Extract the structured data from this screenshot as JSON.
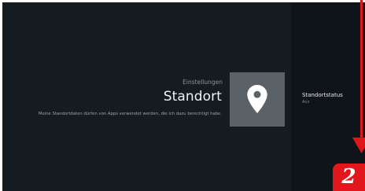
{
  "header": {
    "breadcrumb": "Einstellungen",
    "title": "Standort",
    "description": "Meine Standortdaten dürfen von Apps verwendet werden, die ich dazu berechtigt habe."
  },
  "tile": {
    "icon": "location-pin-icon"
  },
  "settings": {
    "items": [
      {
        "title": "Standortstatus",
        "value": "Aus"
      }
    ]
  },
  "annotation": {
    "step_number": "2",
    "color": "#e2171c"
  },
  "colors": {
    "background": "#141b21",
    "panel": "#0f1418",
    "tile": "#5a6268"
  }
}
